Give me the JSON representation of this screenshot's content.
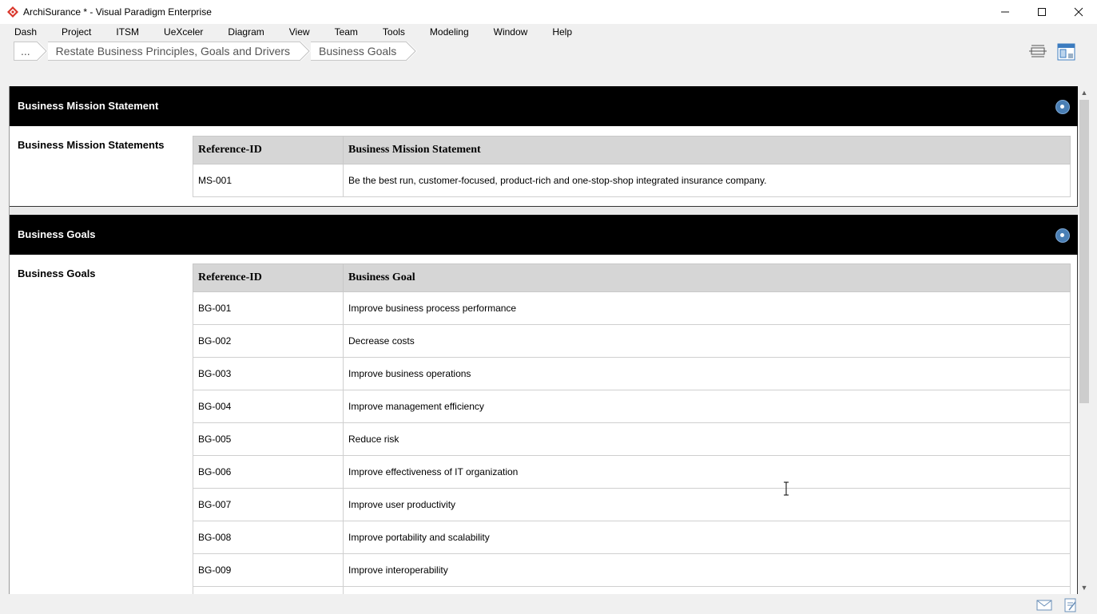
{
  "window": {
    "title": "ArchiSurance * - Visual Paradigm Enterprise",
    "controls": [
      "minimize-icon",
      "maximize-icon",
      "close-icon"
    ],
    "brand_color": "#d9362b"
  },
  "menu": [
    "Dash",
    "Project",
    "ITSM",
    "UeXceler",
    "Diagram",
    "View",
    "Team",
    "Tools",
    "Modeling",
    "Window",
    "Help"
  ],
  "breadcrumb": [
    "...",
    "Restate Business Principles, Goals and Drivers",
    "Business Goals"
  ],
  "sections": {
    "mission": {
      "header": "Business Mission Statement",
      "row_label": "Business Mission Statements",
      "columns": [
        "Reference-ID",
        "Business Mission Statement"
      ],
      "rows": [
        [
          "MS-001",
          "Be the best run, customer-focused, product-rich and one-stop-shop integrated insurance company."
        ]
      ]
    },
    "goals": {
      "header": "Business Goals",
      "row_label": "Business Goals",
      "columns": [
        "Reference-ID",
        "Business Goal"
      ],
      "rows": [
        [
          "BG-001",
          "Improve business process performance"
        ],
        [
          "BG-002",
          "Decrease costs"
        ],
        [
          "BG-003",
          "Improve business operations"
        ],
        [
          "BG-004",
          "Improve management efficiency"
        ],
        [
          "BG-005",
          "Reduce risk"
        ],
        [
          "BG-006",
          "Improve effectiveness of IT organization"
        ],
        [
          "BG-007",
          "Improve user productivity"
        ],
        [
          "BG-008",
          "Improve portability and scalability"
        ],
        [
          "BG-009",
          "Improve interoperability"
        ],
        [
          "",
          ""
        ]
      ]
    }
  },
  "toolbar_icons": [
    "fit-diagram-icon",
    "diagram-navigator-icon"
  ],
  "status_icons": [
    "mail-icon",
    "notes-icon"
  ]
}
